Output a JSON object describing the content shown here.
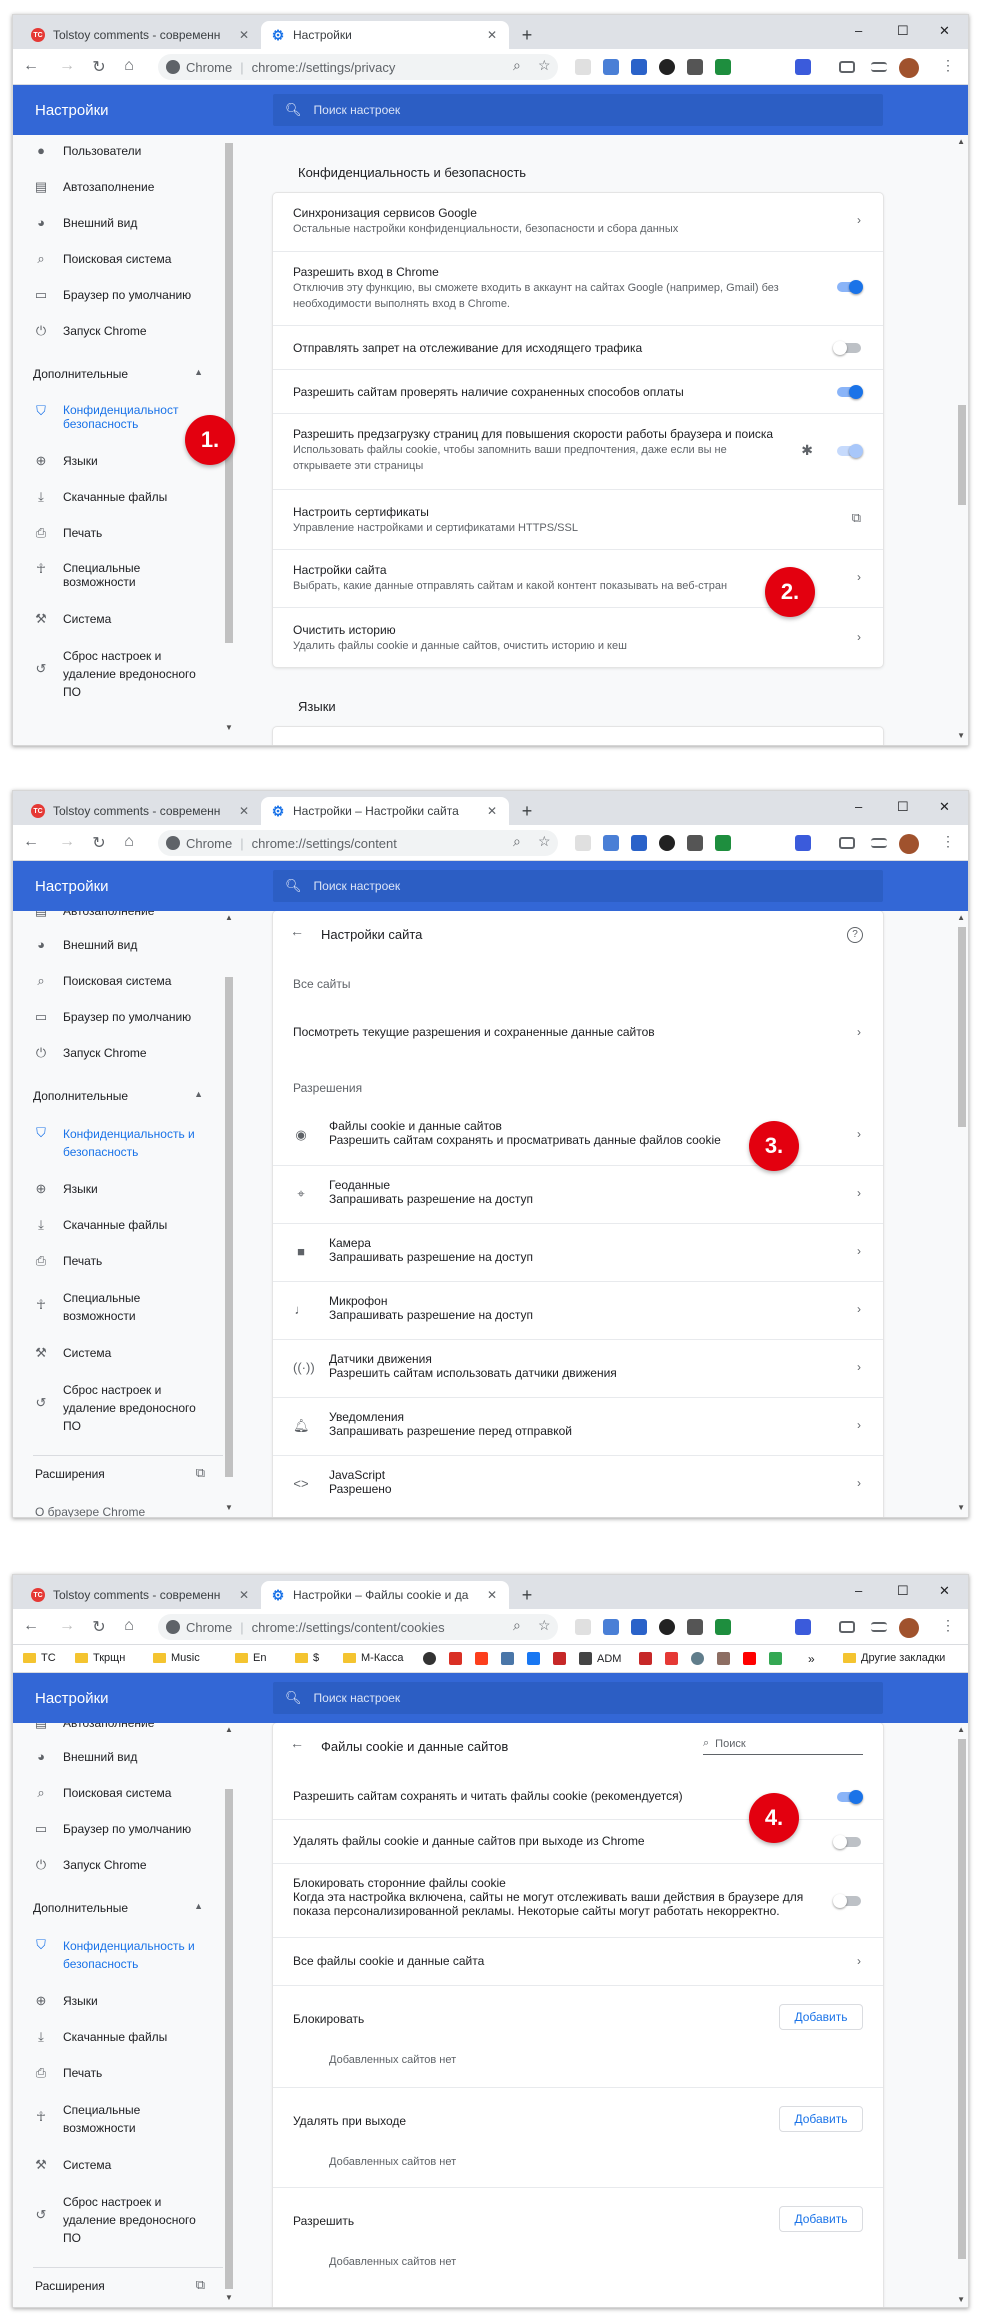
{
  "tabs": {
    "inactive_title": "Tolstoy comments - современн",
    "inactive_favicon": "TC",
    "active_titles": [
      "Настройки",
      "Настройки – Настройки сайта",
      "Настройки – Файлы cookie и да"
    ]
  },
  "omnibox": {
    "host": "Chrome",
    "urls": [
      "chrome://settings/privacy",
      "chrome://settings/content",
      "chrome://settings/content/cookies"
    ]
  },
  "bookmarks": {
    "items": [
      "TC",
      "Ткрщн",
      "Music",
      "En",
      "$",
      "М-Касса",
      "ADM"
    ],
    "other": "Другие закладки"
  },
  "header": {
    "title": "Настройки",
    "search_placeholder": "Поиск настроек"
  },
  "sidebar": {
    "autofill": "Автозаполнение",
    "appearance": "Внешний вид",
    "search_engine": "Поисковая система",
    "default_browser": "Браузер по умолчанию",
    "startup": "Запуск Chrome",
    "advanced": "Дополнительные",
    "privacy_line1": "Конфиденциальность и",
    "privacy_line2": "безопасность",
    "privacy_cut": "Конфиденциальност",
    "languages": "Языки",
    "downloads": "Скачанные файлы",
    "print": "Печать",
    "a11y_line1": "Специальные",
    "a11y_line2": "возможности",
    "system": "Система",
    "reset_line1": "Сброс настроек и",
    "reset_line2": "удаление вредоносного",
    "reset_line3": "ПО",
    "users": "Пользователи",
    "extensions": "Расширения",
    "about": "О браузере Chrome"
  },
  "privacy": {
    "section_title": "Конфиденциальность и безопасность",
    "rows": [
      {
        "title": "Синхронизация сервисов Google",
        "sub": "Остальные настройки конфиденциальности, безопасности и сбора данных"
      },
      {
        "title": "Разрешить вход в Chrome",
        "sub": "Отключив эту функцию, вы сможете входить в аккаунт на сайтах Google (например, Gmail) без",
        "sub2": "необходимости выполнять вход в Chrome."
      },
      {
        "title": "Отправлять запрет на отслеживание для исходящего трафика"
      },
      {
        "title": "Разрешить сайтам проверять наличие сохраненных способов оплаты"
      },
      {
        "title": "Разрешить предзагрузку страниц для повышения скорости работы браузера и поиска",
        "sub": "Использовать файлы cookie, чтобы запомнить ваши предпочтения, даже если вы не",
        "sub2": "открываете эти страницы"
      },
      {
        "title": "Настроить сертификаты",
        "sub": "Управление настройками и сертификатами HTTPS/SSL"
      },
      {
        "title": "Настройки сайта",
        "sub": "Выбрать, какие данные отправлять сайтам и какой контент показывать на веб-стран"
      },
      {
        "title": "Очистить историю",
        "sub": "Удалить файлы cookie и данные сайтов, очистить историю и кеш"
      }
    ],
    "languages_title": "Языки"
  },
  "site_settings": {
    "title": "Настройки сайта",
    "all_sites": "Все сайты",
    "view_perms": "Посмотреть текущие разрешения и сохраненные данные сайтов",
    "permissions": "Разрешения",
    "items": [
      {
        "title": "Файлы cookie и данные сайтов",
        "sub": "Разрешить сайтам сохранять и просматривать данные файлов cookie"
      },
      {
        "title": "Геоданные",
        "sub": "Запрашивать разрешение на доступ"
      },
      {
        "title": "Камера",
        "sub": "Запрашивать разрешение на доступ"
      },
      {
        "title": "Микрофон",
        "sub": "Запрашивать разрешение на доступ"
      },
      {
        "title": "Датчики движения",
        "sub": "Разрешить сайтам использовать датчики движения"
      },
      {
        "title": "Уведомления",
        "sub": "Запрашивать разрешение перед отправкой"
      },
      {
        "title": "JavaScript",
        "sub": "Разрешено"
      }
    ]
  },
  "cookies": {
    "title": "Файлы cookie и данные сайтов",
    "search": "Поиск",
    "allow": "Разрешить сайтам сохранять и читать файлы cookie (рекомендуется)",
    "clear_on_exit": "Удалять файлы cookie и данные сайтов при выходе из Chrome",
    "block_third": "Блокировать сторонние файлы cookie",
    "block_third_sub": "Когда эта настройка включена, сайты не могут отслеживать ваши действия в браузере для",
    "block_third_sub2": "показа персонализированной рекламы. Некоторые сайты могут работать некорректно.",
    "all_cookies": "Все файлы cookie и данные сайта",
    "block": "Блокировать",
    "clear_exit_list": "Удалять при выходе",
    "allow_list": "Разрешить",
    "add": "Добавить",
    "no_sites": "Добавленных сайтов нет"
  },
  "markers": [
    "1.",
    "2.",
    "3.",
    "4."
  ],
  "colors": {
    "header": "#3367d6",
    "accent": "#1a73e8",
    "marker": "#e3000f"
  }
}
